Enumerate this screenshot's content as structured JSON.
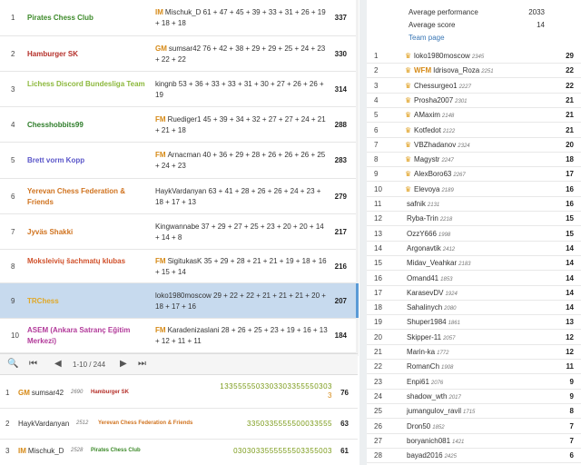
{
  "standings": [
    {
      "rank": "1",
      "team": "Pirates Chess Club",
      "color": "#3d8a2a",
      "title": "IM",
      "lineup": "Mischuk_D 61 + 47 + 45 + 39 + 33 + 31 + 26 + 19 + 18 + 18",
      "score": "337"
    },
    {
      "rank": "2",
      "team": "Hamburger SK",
      "color": "#b5302a",
      "title": "GM",
      "lineup": "sumsar42 76 + 42 + 38 + 29 + 29 + 25 + 24 + 23 + 22 + 22",
      "score": "330"
    },
    {
      "rank": "3",
      "team": "Lichess Discord Bundesliga Team",
      "color": "#8cb83c",
      "title": "",
      "lineup": "kingnb 53 + 36 + 33 + 33 + 31 + 30 + 27 + 26 + 26 + 19",
      "score": "314"
    },
    {
      "rank": "4",
      "team": "Chesshobbits99",
      "color": "#2e7d2a",
      "title": "FM",
      "lineup": "Ruediger1 45 + 39 + 34 + 32 + 27 + 27 + 24 + 21 + 21 + 18",
      "score": "288"
    },
    {
      "rank": "5",
      "team": "Brett vorm Kopp",
      "color": "#5a56c9",
      "title": "FM",
      "lineup": "Arnacman 40 + 36 + 29 + 28 + 26 + 26 + 26 + 25 + 24 + 23",
      "score": "283"
    },
    {
      "rank": "6",
      "team": "Yerevan Chess Federation & Friends",
      "color": "#d0731f",
      "title": "",
      "lineup": "HaykVardanyan 63 + 41 + 28 + 26 + 26 + 24 + 23 + 18 + 17 + 13",
      "score": "279"
    },
    {
      "rank": "7",
      "team": "Jyväs Shakki",
      "color": "#d0731f",
      "title": "",
      "lineup": "Kingwannabe 37 + 29 + 27 + 25 + 23 + 20 + 20 + 14 + 14 + 8",
      "score": "217"
    },
    {
      "rank": "8",
      "team": "Moksleivių šachmatų klubas",
      "color": "#d0502a",
      "title": "FM",
      "lineup": "SigitukasK 35 + 29 + 28 + 21 + 21 + 19 + 18 + 16 + 15 + 14",
      "score": "216"
    },
    {
      "rank": "9",
      "team": "TRChess",
      "color": "#e0a828",
      "title": "",
      "lineup": "loko1980moscow 29 + 22 + 22 + 21 + 21 + 21 + 20 + 18 + 17 + 16",
      "score": "207"
    },
    {
      "rank": "10",
      "team": "ASEM (Ankara Satranç Eğitim Merkezi)",
      "color": "#b23a9a",
      "title": "FM",
      "lineup": "Karadenizaslani 28 + 26 + 25 + 23 + 19 + 16 + 13 + 12 + 11 + 11",
      "score": "184"
    }
  ],
  "pager": {
    "info": "1-10 / 244"
  },
  "players": [
    {
      "rank": "1",
      "title": "GM",
      "name": "sumsar42",
      "rating": "2690",
      "team": "Hamburger SK",
      "team_color": "#b5302a",
      "seq1": "1335555503303303355550303",
      "seq2": "3",
      "score": "76"
    },
    {
      "rank": "2",
      "title": "",
      "name": "HaykVardanyan",
      "rating": "2512",
      "team": "Yerevan Chess Federation & Friends",
      "team_color": "#d0731f",
      "seq1": "3350335555500033555",
      "seq2": "",
      "score": "63"
    },
    {
      "rank": "3",
      "title": "IM",
      "name": "Mischuk_D",
      "rating": "2528",
      "team": "Pirates Chess Club",
      "team_color": "#3d8a2a",
      "seq1": "0303033555555503355003",
      "seq2": "",
      "score": "61"
    }
  ],
  "team_stats": [
    {
      "label": "Average performance",
      "value": "2033"
    },
    {
      "label": "Average score",
      "value": "14"
    }
  ],
  "team_page_link": "Team page",
  "members": [
    {
      "rank": "1",
      "title": "",
      "name": "loko1980moscow",
      "rating": "2345",
      "score": "29",
      "leader": true
    },
    {
      "rank": "2",
      "title": "WFM",
      "name": "Idrisova_Roza",
      "rating": "2251",
      "score": "22",
      "leader": true
    },
    {
      "rank": "3",
      "title": "",
      "name": "Chessurgeo1",
      "rating": "2227",
      "score": "22",
      "leader": true
    },
    {
      "rank": "4",
      "title": "",
      "name": "Prosha2007",
      "rating": "2301",
      "score": "21",
      "leader": true
    },
    {
      "rank": "5",
      "title": "",
      "name": "AMaxim",
      "rating": "2148",
      "score": "21",
      "leader": true
    },
    {
      "rank": "6",
      "title": "",
      "name": "Kotfedot",
      "rating": "2122",
      "score": "21",
      "leader": true
    },
    {
      "rank": "7",
      "title": "",
      "name": "VBZhadanov",
      "rating": "2324",
      "score": "20",
      "leader": true
    },
    {
      "rank": "8",
      "title": "",
      "name": "Magystr",
      "rating": "2247",
      "score": "18",
      "leader": true
    },
    {
      "rank": "9",
      "title": "",
      "name": "AlexBoro63",
      "rating": "2267",
      "score": "17",
      "leader": true
    },
    {
      "rank": "10",
      "title": "",
      "name": "Elevoya",
      "rating": "2189",
      "score": "16",
      "leader": true
    },
    {
      "rank": "11",
      "title": "",
      "name": "safnik",
      "rating": "2131",
      "score": "16",
      "leader": false
    },
    {
      "rank": "12",
      "title": "",
      "name": "Ryba-Trin",
      "rating": "2218",
      "score": "15",
      "leader": false
    },
    {
      "rank": "13",
      "title": "",
      "name": "OzzY666",
      "rating": "1998",
      "score": "15",
      "leader": false
    },
    {
      "rank": "14",
      "title": "",
      "name": "Argonavtik",
      "rating": "2412",
      "score": "14",
      "leader": false
    },
    {
      "rank": "15",
      "title": "",
      "name": "Midav_Veahkar",
      "rating": "2183",
      "score": "14",
      "leader": false
    },
    {
      "rank": "16",
      "title": "",
      "name": "Omand41",
      "rating": "1853",
      "score": "14",
      "leader": false
    },
    {
      "rank": "17",
      "title": "",
      "name": "KarasevDV",
      "rating": "1924",
      "score": "14",
      "leader": false
    },
    {
      "rank": "18",
      "title": "",
      "name": "Sahalinych",
      "rating": "2080",
      "score": "14",
      "leader": false
    },
    {
      "rank": "19",
      "title": "",
      "name": "Shuper1984",
      "rating": "1861",
      "score": "13",
      "leader": false
    },
    {
      "rank": "20",
      "title": "",
      "name": "Skipper-11",
      "rating": "2057",
      "score": "12",
      "leader": false
    },
    {
      "rank": "21",
      "title": "",
      "name": "Marin-ka",
      "rating": "1772",
      "score": "12",
      "leader": false
    },
    {
      "rank": "22",
      "title": "",
      "name": "RomanCh",
      "rating": "1908",
      "score": "11",
      "leader": false
    },
    {
      "rank": "23",
      "title": "",
      "name": "Enpi61",
      "rating": "2076",
      "score": "9",
      "leader": false
    },
    {
      "rank": "24",
      "title": "",
      "name": "shadow_wth",
      "rating": "2017",
      "score": "9",
      "leader": false
    },
    {
      "rank": "25",
      "title": "",
      "name": "jumangulov_ravil",
      "rating": "1715",
      "score": "8",
      "leader": false
    },
    {
      "rank": "26",
      "title": "",
      "name": "Dron50",
      "rating": "1852",
      "score": "7",
      "leader": false
    },
    {
      "rank": "27",
      "title": "",
      "name": "boryanich081",
      "rating": "1421",
      "score": "7",
      "leader": false
    },
    {
      "rank": "28",
      "title": "",
      "name": "bayad2016",
      "rating": "2425",
      "score": "6",
      "leader": false
    }
  ]
}
